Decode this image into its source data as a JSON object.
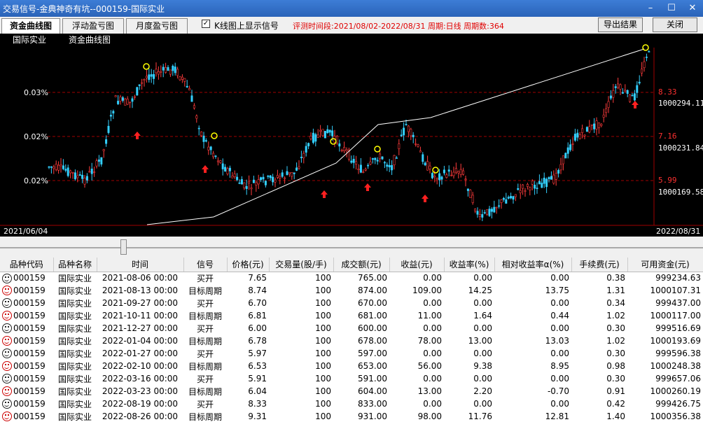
{
  "window": {
    "title": "交易信号-金典神奇有坑--000159-国际实业",
    "controls": [
      "–",
      "☐",
      "✕"
    ]
  },
  "toolbar": {
    "tabs": [
      "资金曲线图",
      "浮动盈亏图",
      "月度盈亏图"
    ],
    "checkbox_label": "K线图上显示信号",
    "checkbox_checked": true,
    "eval_info": "评测时间段:2021/08/02-2022/08/31  周期:日线  周期数:364",
    "export_button": "导出结果",
    "close_button": "关闭"
  },
  "chart": {
    "legend": [
      "国际实业",
      "资金曲线图"
    ],
    "left_ticks": [
      "0.03%",
      "0.02%",
      "0.02%"
    ],
    "right_price_ticks": [
      "8.33",
      "7.16",
      "5.99"
    ],
    "right_equity_ticks": [
      "1000294.11",
      "1000231.84",
      "1000169.58"
    ],
    "start_date": "2021/06/04",
    "end_date": "2022/08/31",
    "colors": {
      "up": "#ff3b3b",
      "down": "#33d0ff",
      "equity": "#ffffff",
      "signal": "#ffff00",
      "arrow": "#ff2020",
      "grid": "#a00000"
    }
  },
  "table": {
    "headers": [
      "品种代码",
      "品种名称",
      "时间",
      "信号",
      "价格(元)",
      "交易量(股/手)",
      "成交额(元)",
      "收益(元)",
      "收益率(%)",
      "相对收益率α(%)",
      "手续费(元)",
      "可用资金(元)"
    ],
    "rows": [
      [
        "000159",
        "国际实业",
        "2021-08-06 00:00",
        "买开",
        "7.65",
        "100",
        "765.00",
        "0.00",
        "0.00",
        "0.00",
        "0.38",
        "999234.63"
      ],
      [
        "000159",
        "国际实业",
        "2021-08-13 00:00",
        "目标周期",
        "8.74",
        "100",
        "874.00",
        "109.00",
        "14.25",
        "13.75",
        "1.31",
        "1000107.31"
      ],
      [
        "000159",
        "国际实业",
        "2021-09-27 00:00",
        "买开",
        "6.70",
        "100",
        "670.00",
        "0.00",
        "0.00",
        "0.00",
        "0.34",
        "999437.00"
      ],
      [
        "000159",
        "国际实业",
        "2021-10-11 00:00",
        "目标周期",
        "6.81",
        "100",
        "681.00",
        "11.00",
        "1.64",
        "0.44",
        "1.02",
        "1000117.00"
      ],
      [
        "000159",
        "国际实业",
        "2021-12-27 00:00",
        "买开",
        "6.00",
        "100",
        "600.00",
        "0.00",
        "0.00",
        "0.00",
        "0.30",
        "999516.69"
      ],
      [
        "000159",
        "国际实业",
        "2022-01-04 00:00",
        "目标周期",
        "6.78",
        "100",
        "678.00",
        "78.00",
        "13.00",
        "13.03",
        "1.02",
        "1000193.69"
      ],
      [
        "000159",
        "国际实业",
        "2022-01-27 00:00",
        "买开",
        "5.97",
        "100",
        "597.00",
        "0.00",
        "0.00",
        "0.00",
        "0.30",
        "999596.38"
      ],
      [
        "000159",
        "国际实业",
        "2022-02-10 00:00",
        "目标周期",
        "6.53",
        "100",
        "653.00",
        "56.00",
        "9.38",
        "8.95",
        "0.98",
        "1000248.38"
      ],
      [
        "000159",
        "国际实业",
        "2022-03-16 00:00",
        "买开",
        "5.91",
        "100",
        "591.00",
        "0.00",
        "0.00",
        "0.00",
        "0.30",
        "999657.06"
      ],
      [
        "000159",
        "国际实业",
        "2022-03-23 00:00",
        "目标周期",
        "6.04",
        "100",
        "604.00",
        "13.00",
        "2.20",
        "-0.70",
        "0.91",
        "1000260.19"
      ],
      [
        "000159",
        "国际实业",
        "2022-08-19 00:00",
        "买开",
        "8.33",
        "100",
        "833.00",
        "0.00",
        "0.00",
        "0.00",
        "0.42",
        "999426.75"
      ],
      [
        "000159",
        "国际实业",
        "2022-08-26 00:00",
        "目标周期",
        "9.31",
        "100",
        "931.00",
        "98.00",
        "11.76",
        "12.81",
        "1.40",
        "1000356.38"
      ]
    ],
    "row_icons": [
      "dark",
      "red",
      "dark",
      "red",
      "dark",
      "red",
      "dark",
      "red",
      "dark",
      "red",
      "dark",
      "red"
    ]
  }
}
